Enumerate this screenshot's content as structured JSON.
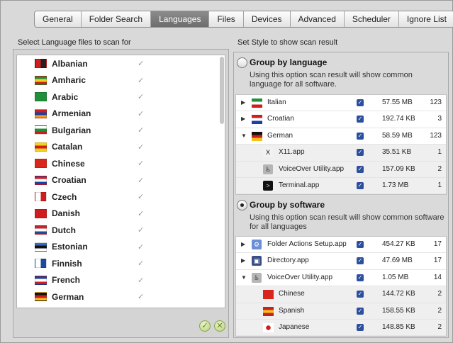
{
  "tabs": [
    "General",
    "Folder Search",
    "Languages",
    "Files",
    "Devices",
    "Advanced",
    "Scheduler",
    "Ignore List"
  ],
  "active_tab": "Languages",
  "left_panel": {
    "title": "Select Language files to scan for",
    "languages": [
      {
        "name": "Albanian",
        "colors": [
          "#d01c1c",
          "#222222"
        ]
      },
      {
        "name": "Amharic",
        "colors": [
          "#1f8f3a",
          "#f2d21b",
          "#d01c1c"
        ]
      },
      {
        "name": "Arabic",
        "colors": [
          "#1f8f3a",
          "#1f8f3a"
        ]
      },
      {
        "name": "Armenian",
        "colors": [
          "#d01c1c",
          "#1b3fa8",
          "#f2a21b"
        ]
      },
      {
        "name": "Bulgarian",
        "colors": [
          "#ffffff",
          "#1f8f3a",
          "#d01c1c"
        ]
      },
      {
        "name": "Catalan",
        "colors": [
          "#f2d21b",
          "#d01c1c",
          "#f2d21b"
        ]
      },
      {
        "name": "Chinese",
        "colors": [
          "#d8261d",
          "#d8261d"
        ]
      },
      {
        "name": "Croatian",
        "colors": [
          "#d01c1c",
          "#ffffff",
          "#1b3fa8"
        ]
      },
      {
        "name": "Czech",
        "colors": [
          "#ffffff",
          "#d01c1c"
        ]
      },
      {
        "name": "Danish",
        "colors": [
          "#d01c1c",
          "#d01c1c"
        ]
      },
      {
        "name": "Dutch",
        "colors": [
          "#c0262d",
          "#ffffff",
          "#214a94"
        ]
      },
      {
        "name": "Estonian",
        "colors": [
          "#2f6ec2",
          "#111111",
          "#ffffff"
        ]
      },
      {
        "name": "Finnish",
        "colors": [
          "#ffffff",
          "#1d4a9c"
        ]
      },
      {
        "name": "French",
        "colors": [
          "#1f3f9c",
          "#ffffff",
          "#d01c1c"
        ]
      },
      {
        "name": "German",
        "colors": [
          "#111111",
          "#d01c1c",
          "#f2c21b"
        ]
      }
    ],
    "check_glyph": "✓"
  },
  "right_panel": {
    "title": "Set Style to show scan result",
    "group_language": {
      "title": "Group by language",
      "desc": "Using this option scan result will show common language for all software.",
      "rows": [
        {
          "name": "Italian",
          "size": "57.55 MB",
          "count": "123",
          "expand": "▶",
          "child": false,
          "icon": "flag",
          "colors": [
            "#1f8f3a",
            "#ffffff",
            "#d01c1c"
          ]
        },
        {
          "name": "Croatian",
          "size": "192.74 KB",
          "count": "3",
          "expand": "▶",
          "child": false,
          "icon": "flag",
          "colors": [
            "#d01c1c",
            "#ffffff",
            "#1b3fa8"
          ]
        },
        {
          "name": "German",
          "size": "58.59 MB",
          "count": "123",
          "expand": "▼",
          "child": false,
          "icon": "flag",
          "colors": [
            "#111111",
            "#d01c1c",
            "#f2c21b"
          ]
        },
        {
          "name": "X11.app",
          "size": "35.51 KB",
          "count": "1",
          "expand": "",
          "child": true,
          "icon": "x11-app-icon"
        },
        {
          "name": "VoiceOver Utility.app",
          "size": "157.09 KB",
          "count": "2",
          "expand": "",
          "child": true,
          "icon": "voiceover-app-icon"
        },
        {
          "name": "Terminal.app",
          "size": "1.73 MB",
          "count": "1",
          "expand": "",
          "child": true,
          "icon": "terminal-app-icon"
        }
      ]
    },
    "group_software": {
      "title": "Group by software",
      "desc": "Using this option scan result will show common software for all languages",
      "rows": [
        {
          "name": "Folder Actions Setup.app",
          "size": "454.27 KB",
          "count": "17",
          "expand": "▶",
          "child": false,
          "icon": "folder-actions-app-icon"
        },
        {
          "name": "Directory.app",
          "size": "47.69 MB",
          "count": "17",
          "expand": "▶",
          "child": false,
          "icon": "directory-app-icon"
        },
        {
          "name": "VoiceOver Utility.app",
          "size": "1.05 MB",
          "count": "14",
          "expand": "▼",
          "child": false,
          "icon": "voiceover-app-icon"
        },
        {
          "name": "Chinese",
          "size": "144.72 KB",
          "count": "2",
          "expand": "",
          "child": true,
          "icon": "flag",
          "colors": [
            "#d8261d",
            "#d8261d"
          ]
        },
        {
          "name": "Spanish",
          "size": "158.55 KB",
          "count": "2",
          "expand": "",
          "child": true,
          "icon": "flag",
          "colors": [
            "#c8201e",
            "#f2c21b",
            "#c8201e"
          ]
        },
        {
          "name": "Japanese",
          "size": "148.85 KB",
          "count": "2",
          "expand": "",
          "child": true,
          "icon": "flag",
          "colors": [
            "#ffffff",
            "#ffffff"
          ]
        }
      ]
    },
    "check_glyph": "✓"
  },
  "buttons": {
    "ok_glyph": "✓",
    "cancel_glyph": "✕"
  }
}
